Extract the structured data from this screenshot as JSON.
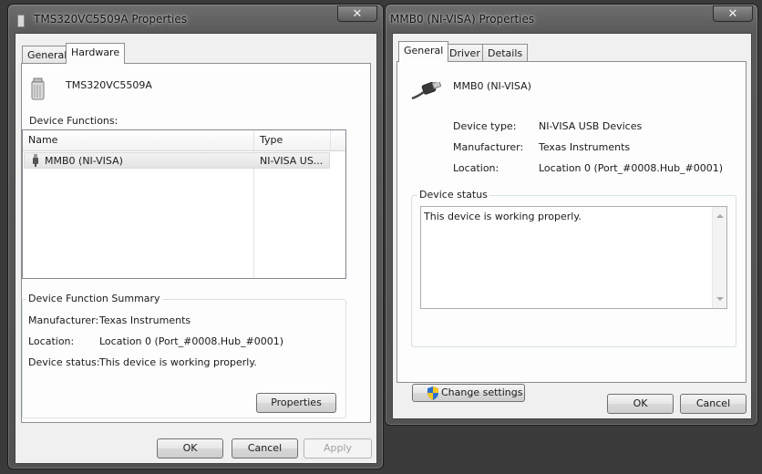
{
  "window1": {
    "title": "TMS320VC5509A Properties",
    "close_glyph": "✕",
    "tabs": [
      {
        "label": "General"
      },
      {
        "label": "Hardware"
      }
    ],
    "device_name": "TMS320VC5509A",
    "device_functions_label": "Device Functions:",
    "list": {
      "columns": [
        "Name",
        "Type"
      ],
      "rows": [
        {
          "name": "MMB0 (NI-VISA)",
          "type": "NI-VISA US..."
        }
      ]
    },
    "summary": {
      "title": "Device Function Summary",
      "manufacturer_label": "Manufacturer:",
      "manufacturer_value": "Texas Instruments",
      "location_label": "Location:",
      "location_value": "Location 0 (Port_#0008.Hub_#0001)",
      "status_label": "Device status:",
      "status_value": "This device is working properly.",
      "properties_button": "Properties"
    },
    "buttons": {
      "ok": "OK",
      "cancel": "Cancel",
      "apply": "Apply"
    }
  },
  "window2": {
    "title": "MMB0 (NI-VISA) Properties",
    "close_glyph": "✕",
    "tabs": [
      {
        "label": "General"
      },
      {
        "label": "Driver"
      },
      {
        "label": "Details"
      }
    ],
    "device_name": "MMB0 (NI-VISA)",
    "device_type_label": "Device type:",
    "device_type_value": "NI-VISA USB Devices",
    "manufacturer_label": "Manufacturer:",
    "manufacturer_value": "Texas Instruments",
    "location_label": "Location:",
    "location_value": "Location 0 (Port_#0008.Hub_#0001)",
    "status_group_title": "Device status",
    "status_text": "This device is working properly.",
    "change_settings_button": "Change settings",
    "buttons": {
      "ok": "OK",
      "cancel": "Cancel"
    }
  }
}
